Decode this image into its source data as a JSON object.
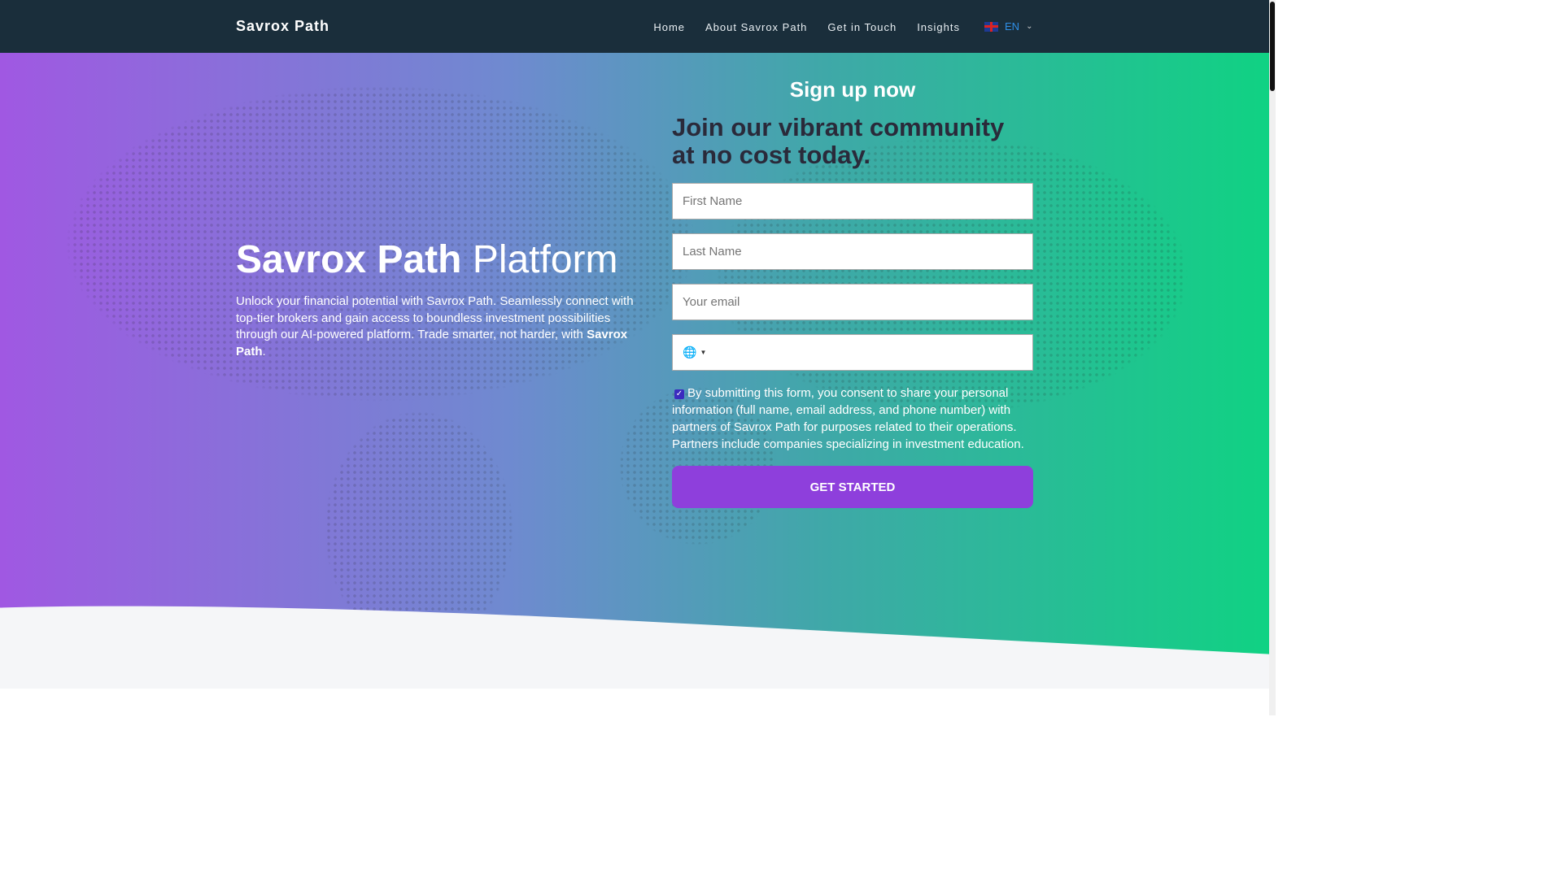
{
  "nav": {
    "brand": "Savrox Path",
    "links": [
      "Home",
      "About Savrox Path",
      "Get in Touch",
      "Insights"
    ],
    "language": "EN"
  },
  "hero": {
    "title_bold": "Savrox Path",
    "title_light": "Platform",
    "description": "Unlock your financial potential with Savrox Path. Seamlessly connect with top-tier brokers and gain access to boundless investment possibilities through our AI-powered platform. Trade smarter, not harder, with ",
    "description_bold": "Savrox Path",
    "description_end": "."
  },
  "form": {
    "heading": "Sign up now",
    "subheading": "Join our vibrant community at no cost today.",
    "first_name_placeholder": "First Name",
    "last_name_placeholder": "Last Name",
    "email_placeholder": "Your email",
    "consent_checked": true,
    "consent": "By submitting this form, you consent to share your personal information (full name, email address, and phone number) with partners of Savrox Path for purposes related to their operations. Partners include companies specializing in investment education.",
    "submit": "GET STARTED"
  },
  "colors": {
    "nav_bg": "#1a2e3b",
    "button": "#8e3fdc",
    "gradient_start": "#a058e2",
    "gradient_end": "#10d283"
  }
}
